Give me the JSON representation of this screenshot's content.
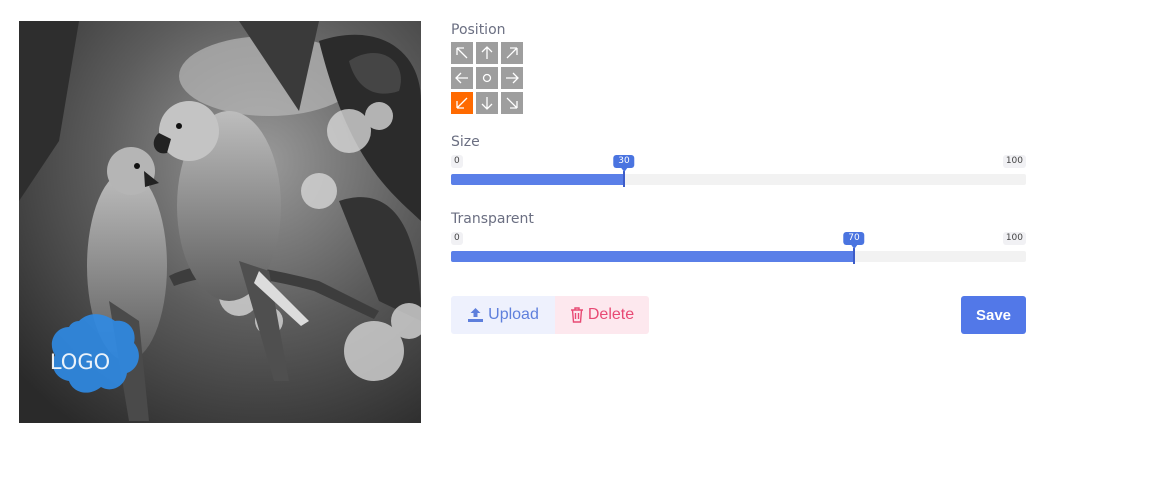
{
  "preview": {
    "watermark_text": "LOGO",
    "watermark_color": "#2f8be6",
    "image_description_icon": "parrots-photo"
  },
  "position": {
    "label": "Position",
    "cells": [
      {
        "icon": "arrow-up-left-icon",
        "glyph": "nw"
      },
      {
        "icon": "arrow-up-icon",
        "glyph": "n"
      },
      {
        "icon": "arrow-up-right-icon",
        "glyph": "ne"
      },
      {
        "icon": "arrow-left-icon",
        "glyph": "w"
      },
      {
        "icon": "center-circle-icon",
        "glyph": "c"
      },
      {
        "icon": "arrow-right-icon",
        "glyph": "e"
      },
      {
        "icon": "arrow-down-left-icon",
        "glyph": "sw"
      },
      {
        "icon": "arrow-down-icon",
        "glyph": "s"
      },
      {
        "icon": "arrow-down-right-icon",
        "glyph": "se"
      }
    ],
    "selected": "sw",
    "active_color": "#ff6a00"
  },
  "size": {
    "label": "Size",
    "min": "0",
    "max": "100",
    "value": 30,
    "value_label": "30"
  },
  "transparent": {
    "label": "Transparent",
    "min": "0",
    "max": "100",
    "value": 70,
    "value_label": "70"
  },
  "actions": {
    "upload_label": "Upload",
    "delete_label": "Delete",
    "save_label": "Save"
  },
  "colors": {
    "accent": "#5278e8",
    "delete": "#e84a74"
  }
}
